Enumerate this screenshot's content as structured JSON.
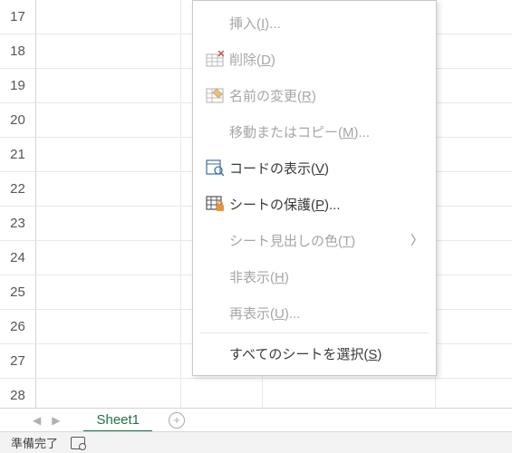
{
  "rows": [
    "17",
    "18",
    "19",
    "20",
    "21",
    "22",
    "23",
    "24",
    "25",
    "26",
    "27",
    "28"
  ],
  "sheet_tab": "Sheet1",
  "status": "準備完了",
  "menu": {
    "insert": "挿入(<u>I</u>)...",
    "delete": "削除(<u>D</u>)",
    "rename": "名前の変更(<u>R</u>)",
    "move": "移動またはコピー(<u>M</u>)...",
    "viewcode": "コードの表示(<u>V</u>)",
    "protect": "シートの保護(<u>P</u>)...",
    "tabcolor": "シート見出しの色(<u>T</u>)",
    "hide": "非表示(<u>H</u>)",
    "unhide": "再表示(<u>U</u>)...",
    "selectall": "すべてのシートを選択(<u>S</u>)"
  }
}
